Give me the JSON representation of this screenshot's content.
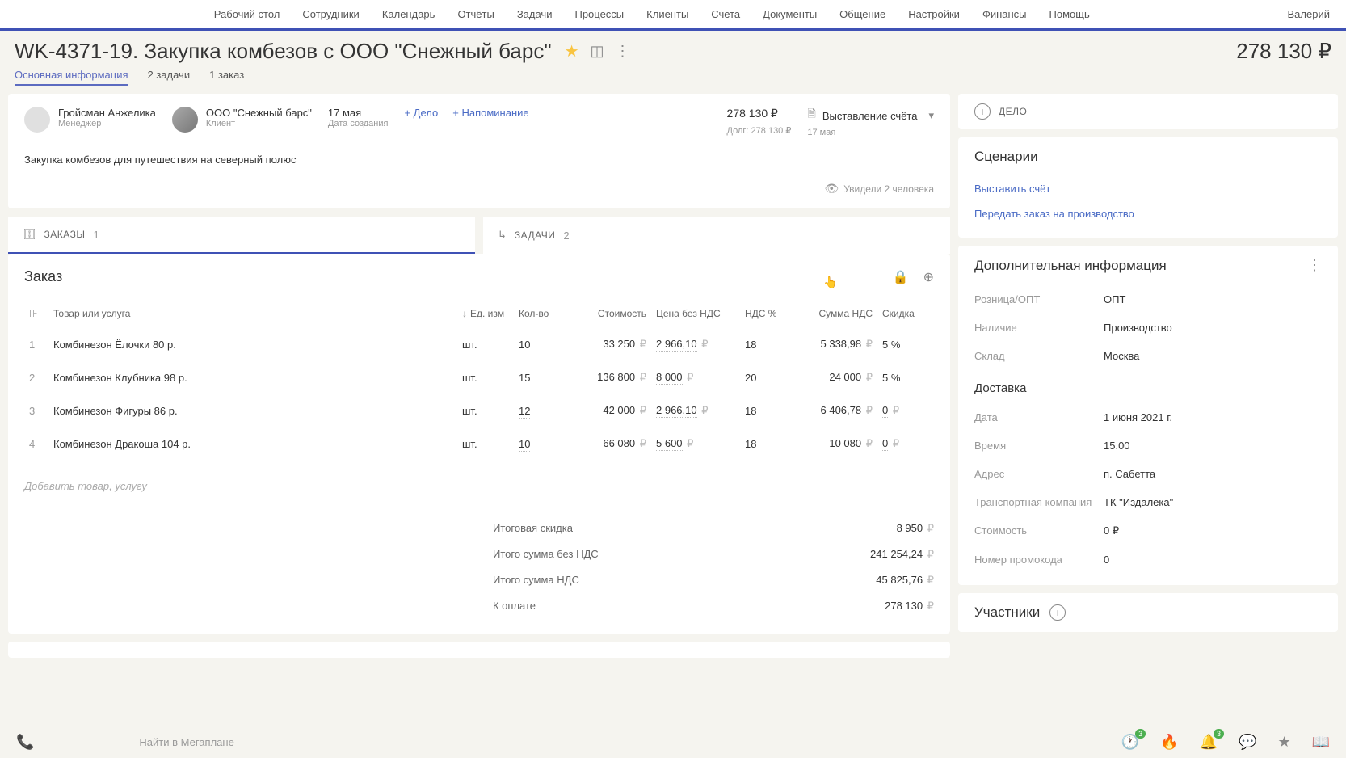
{
  "topnav": {
    "items": [
      "Рабочий стол",
      "Сотрудники",
      "Календарь",
      "Отчёты",
      "Задачи",
      "Процессы",
      "Клиенты",
      "Счета",
      "Документы",
      "Общение",
      "Настройки",
      "Финансы",
      "Помощь"
    ],
    "user": "Валерий"
  },
  "header": {
    "title": "WK-4371-19. Закупка комбезов с ООО \"Снежный барс\"",
    "amount": "278 130 ₽"
  },
  "tabs": {
    "items": [
      "Основная информация",
      "2 задачи",
      "1 заказ"
    ],
    "active_index": 0
  },
  "summary": {
    "manager": {
      "name": "Гройсман Анжелика",
      "role": "Менеджер"
    },
    "client": {
      "name": "ООО \"Снежный барс\"",
      "role": "Клиент"
    },
    "date": {
      "value": "17 мая",
      "label": "Дата создания"
    },
    "links": {
      "deal": "+ Дело",
      "reminder": "+ Напоминание"
    },
    "amount": {
      "value": "278 130 ₽",
      "debt": "Долг: 278 130 ₽"
    },
    "status": {
      "text": "Выставление счёта",
      "date": "17 мая"
    },
    "description": "Закупка комбезов для путешествия на северный полюс",
    "views": "Увидели 2 человека"
  },
  "section_tabs": {
    "orders": {
      "label": "ЗАКАЗЫ",
      "count": "1"
    },
    "tasks": {
      "label": "ЗАДАЧИ",
      "count": "2"
    }
  },
  "order": {
    "title": "Заказ",
    "columns": {
      "name": "Товар или услуга",
      "unit": "Ед. изм",
      "qty": "Кол-во",
      "cost": "Стоимость",
      "price_no_vat": "Цена без НДС",
      "vat_pct": "НДС %",
      "vat_sum": "Сумма НДС",
      "discount": "Скидка"
    },
    "rows": [
      {
        "n": "1",
        "name": "Комбинезон Ёлочки 80 р.",
        "unit": "шт.",
        "qty": "10",
        "cost": "33 250",
        "price_no_vat": "2 966,10",
        "vat_pct": "18",
        "vat_sum": "5 338,98",
        "discount": "5 %"
      },
      {
        "n": "2",
        "name": "Комбинезон Клубника 98 р.",
        "unit": "шт.",
        "qty": "15",
        "cost": "136 800",
        "price_no_vat": "8 000",
        "vat_pct": "20",
        "vat_sum": "24 000",
        "discount": "5 %"
      },
      {
        "n": "3",
        "name": "Комбинезон Фигуры 86 р.",
        "unit": "шт.",
        "qty": "12",
        "cost": "42 000",
        "price_no_vat": "2 966,10",
        "vat_pct": "18",
        "vat_sum": "6 406,78",
        "discount": "0"
      },
      {
        "n": "4",
        "name": "Комбинезон Дракоша 104 р.",
        "unit": "шт.",
        "qty": "10",
        "cost": "66 080",
        "price_no_vat": "5 600",
        "vat_pct": "18",
        "vat_sum": "10 080",
        "discount": "0"
      }
    ],
    "add_placeholder": "Добавить товар, услугу",
    "totals": {
      "discount": {
        "label": "Итоговая скидка",
        "value": "8 950"
      },
      "sum_no_vat": {
        "label": "Итого сумма без НДС",
        "value": "241 254,24"
      },
      "sum_vat": {
        "label": "Итого сумма НДС",
        "value": "45 825,76"
      },
      "to_pay": {
        "label": "К оплате",
        "value": "278 130"
      }
    }
  },
  "sidebar": {
    "deal_label": "ДЕЛО",
    "scenarios": {
      "title": "Сценарии",
      "items": [
        "Выставить счёт",
        "Передать заказ на производство"
      ]
    },
    "addinfo": {
      "title": "Дополнительная информация",
      "retail": {
        "label": "Розница/ОПТ",
        "value": "ОПТ"
      },
      "stock": {
        "label": "Наличие",
        "value": "Производство"
      },
      "warehouse": {
        "label": "Склад",
        "value": "Москва"
      },
      "delivery_title": "Доставка",
      "date": {
        "label": "Дата",
        "value": "1 июня 2021 г."
      },
      "time": {
        "label": "Время",
        "value": "15.00"
      },
      "address": {
        "label": "Адрес",
        "value": "п. Сабетта"
      },
      "carrier": {
        "label": "Транспортная компания",
        "value": "ТК \"Издалека\""
      },
      "cost": {
        "label": "Стоимость",
        "value": "0 ₽"
      },
      "promo": {
        "label": "Номер промокода",
        "value": "0"
      }
    },
    "participants": {
      "title": "Участники"
    }
  },
  "footer": {
    "search_placeholder": "Найти в Мегаплане",
    "badge1": "3",
    "badge2": "3"
  }
}
